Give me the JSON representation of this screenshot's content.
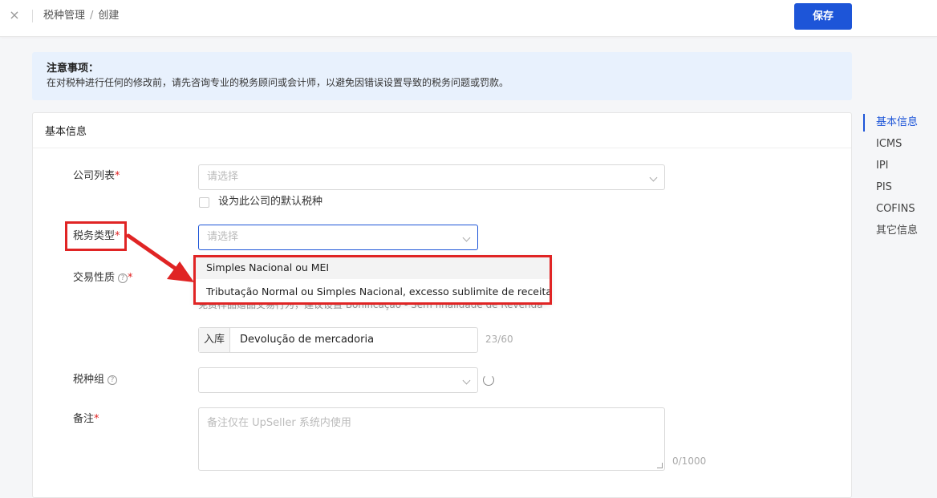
{
  "header": {
    "close_icon": "×",
    "breadcrumb_parent": "税种管理",
    "breadcrumb_sep": "/",
    "breadcrumb_current": "创建",
    "save_label": "保存"
  },
  "notice": {
    "title": "注意事项：",
    "text": "在对税种进行任何的修改前，请先咨询专业的税务顾问或会计师，以避免因错误设置导致的税务问题或罚款。"
  },
  "section": {
    "title": "基本信息"
  },
  "form": {
    "company": {
      "label": "公司列表",
      "required": "*",
      "placeholder": "请选择"
    },
    "default_checkbox": {
      "label": "设为此公司的默认税种"
    },
    "tax_type": {
      "label": "税务类型",
      "required": "*",
      "placeholder": "请选择"
    },
    "transaction": {
      "label": "交易性质",
      "help": "?",
      "required": "*",
      "hint": "免费样品赠品交易行为，建议设置 Bonificação - Sem finalidade de Revenda"
    },
    "inbound": {
      "addon": "入库",
      "value": "Devolução de mercadoria",
      "counter": "23/60"
    },
    "tax_group": {
      "label": "税种组",
      "help": "?"
    },
    "remark": {
      "label": "备注",
      "required": "*",
      "placeholder": "备注仅在 UpSeller 系统内使用",
      "counter": "0/1000"
    }
  },
  "dropdown": {
    "options": [
      "Simples Nacional ou MEI",
      "Tributação Normal ou Simples Nacional, excesso sublimite de receita bruta"
    ]
  },
  "toc": {
    "items": [
      "基本信息",
      "ICMS",
      "IPI",
      "PIS",
      "COFINS",
      "其它信息"
    ]
  },
  "colors": {
    "accent": "#1d55d8",
    "highlight": "#e02424"
  }
}
